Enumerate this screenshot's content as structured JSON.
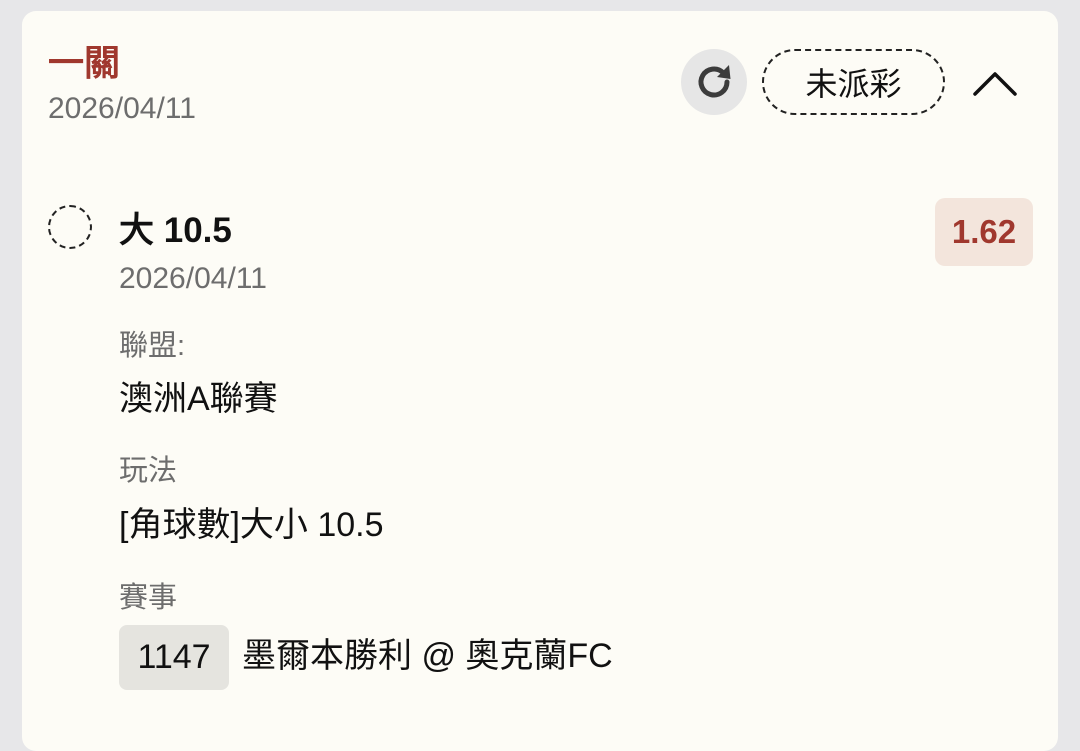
{
  "bet": {
    "type": "一關",
    "date": "2026/04/11",
    "status": "未派彩"
  },
  "icons": {
    "refresh": "refresh-icon",
    "collapse": "chevron-up-icon",
    "selection_status": "pending-dashed-circle-icon"
  },
  "colors": {
    "accent": "#a0382e",
    "card_background": "#fdfcf6",
    "page_background": "#e7e7e9",
    "odds_background": "#f3e5dc"
  },
  "selection": {
    "name": "大 10.5",
    "date": "2026/04/11",
    "odds": "1.62",
    "league_label": "聯盟:",
    "league_value": "澳洲A聯賽",
    "market_label": "玩法",
    "market_value": "[角球數]大小 10.5",
    "event_label": "賽事",
    "event_code": "1147",
    "event_name": "墨爾本勝利 @ 奧克蘭FC"
  }
}
